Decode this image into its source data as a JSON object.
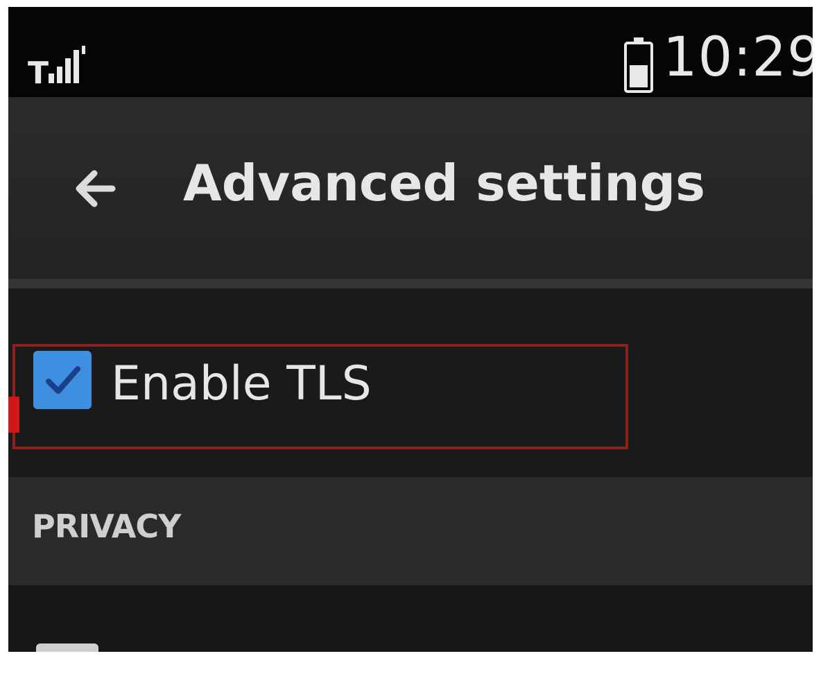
{
  "status_bar": {
    "carrier_indicator": "T",
    "signal_icon": "signal-bars-icon",
    "battery_icon": "battery-icon",
    "time": "10:29"
  },
  "header": {
    "back_icon": "arrow-left-icon",
    "title": "Advanced settings"
  },
  "settings": {
    "tls": {
      "label": "Enable TLS",
      "checked": true,
      "checkbox_color": "#3f8fe0",
      "highlight_color": "#8a2020"
    }
  },
  "sections": {
    "privacy": {
      "label": "PRIVACY"
    }
  }
}
